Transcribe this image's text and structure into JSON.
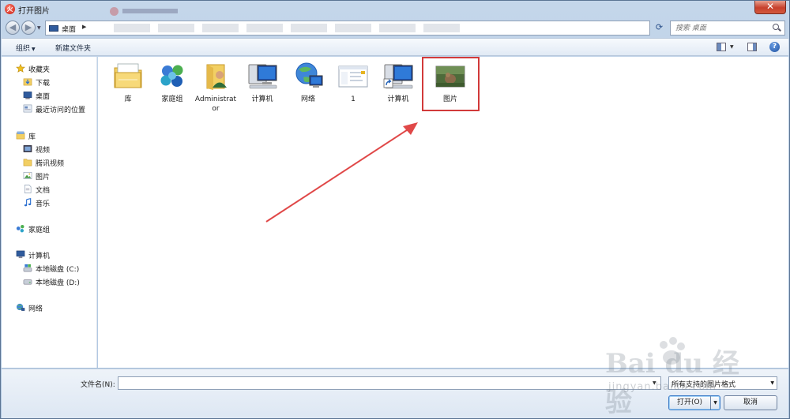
{
  "window": {
    "title": "打开图片",
    "close_glyph": "✕",
    "app_glyph": "火"
  },
  "navigation": {
    "address_current": "桌面",
    "search_placeholder": "搜索 桌面"
  },
  "toolbar": {
    "organize": "组织",
    "new_folder": "新建文件夹",
    "help_glyph": "?"
  },
  "sidebar": {
    "favorites": {
      "label": "收藏夹",
      "icon": "star-icon",
      "items": [
        "下载",
        "桌面",
        "最近访问的位置"
      ]
    },
    "libraries": {
      "label": "库",
      "icon": "library-icon",
      "items": [
        "视频",
        "腾讯视频",
        "图片",
        "文档",
        "音乐"
      ]
    },
    "homegroup": {
      "label": "家庭组",
      "icon": "homegroup-icon"
    },
    "computer": {
      "label": "计算机",
      "icon": "computer-icon",
      "items": [
        "本地磁盘 (C:)",
        "本地磁盘 (D:)"
      ]
    },
    "network": {
      "label": "网络",
      "icon": "network-icon"
    }
  },
  "files": [
    {
      "name": "库",
      "icon": "library-folder-icon"
    },
    {
      "name": "家庭组",
      "icon": "homegroup-icon"
    },
    {
      "name": "Administrator",
      "icon": "user-folder-icon"
    },
    {
      "name": "计算机",
      "icon": "computer-icon"
    },
    {
      "name": "网络",
      "icon": "network-globe-icon"
    },
    {
      "name": "1",
      "icon": "document-thumbnail-icon"
    },
    {
      "name": "计算机",
      "icon": "computer-shortcut-icon"
    },
    {
      "name": "图片",
      "icon": "image-thumbnail-icon"
    }
  ],
  "bottom": {
    "filename_label": "文件名(N):",
    "filename_value": "",
    "filter_value": "所有支持的图片格式",
    "open_button": "打开(O)",
    "cancel_button": "取消"
  },
  "watermark": {
    "logo": "Bai du 经验",
    "sub": "jingyan.baidu.com"
  },
  "colors": {
    "highlight": "#d23a3a",
    "arrow": "#e04848"
  }
}
